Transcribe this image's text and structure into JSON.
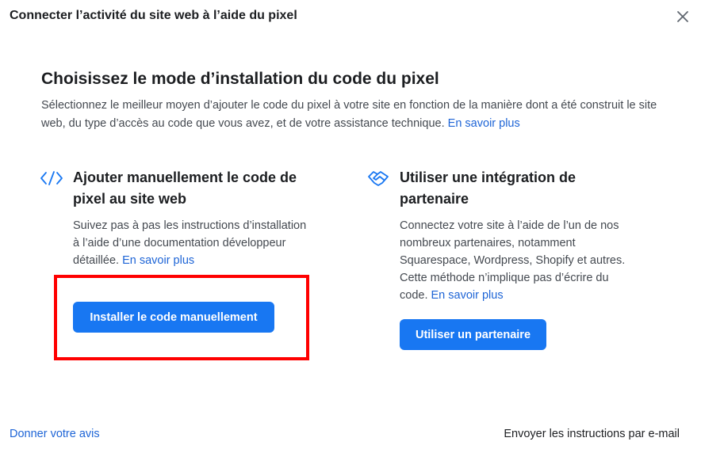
{
  "dialog": {
    "title": "Connecter l’activité du site web à l’aide du pixel",
    "close_icon": "close-icon"
  },
  "main": {
    "heading": "Choisissez le mode d’installation du code du pixel",
    "description": "Sélectionnez le meilleur moyen d’ajouter le code du pixel à votre site en fonction de la manière dont a été construit le site web, du type d’accès au code que vous avez, et de votre assistance technique.",
    "learn_more": "En savoir plus"
  },
  "options": {
    "manual": {
      "icon": "code-icon",
      "title": "Ajouter manuellement le code de pixel au site web",
      "description": "Suivez pas à pas les instructions d’installation à l’aide d’une documentation développeur détaillée.",
      "learn_more": "En savoir plus",
      "button_label": "Installer le code manuellement"
    },
    "partner": {
      "icon": "handshake-icon",
      "title": "Utiliser une intégration de partenaire",
      "description": "Connectez votre site à l’aide de l’un de nos nombreux partenaires, notamment Squarespace, Wordpress, Shopify et autres. Cette méthode n’implique pas d’écrire du code.",
      "learn_more": "En savoir plus",
      "button_label": "Utiliser un partenaire"
    }
  },
  "footer": {
    "feedback_link": "Donner votre avis",
    "email_instructions": "Envoyer les instructions par e-mail"
  },
  "colors": {
    "accent": "#1877f2",
    "link": "#1d64d6",
    "highlight": "#ff0000"
  }
}
